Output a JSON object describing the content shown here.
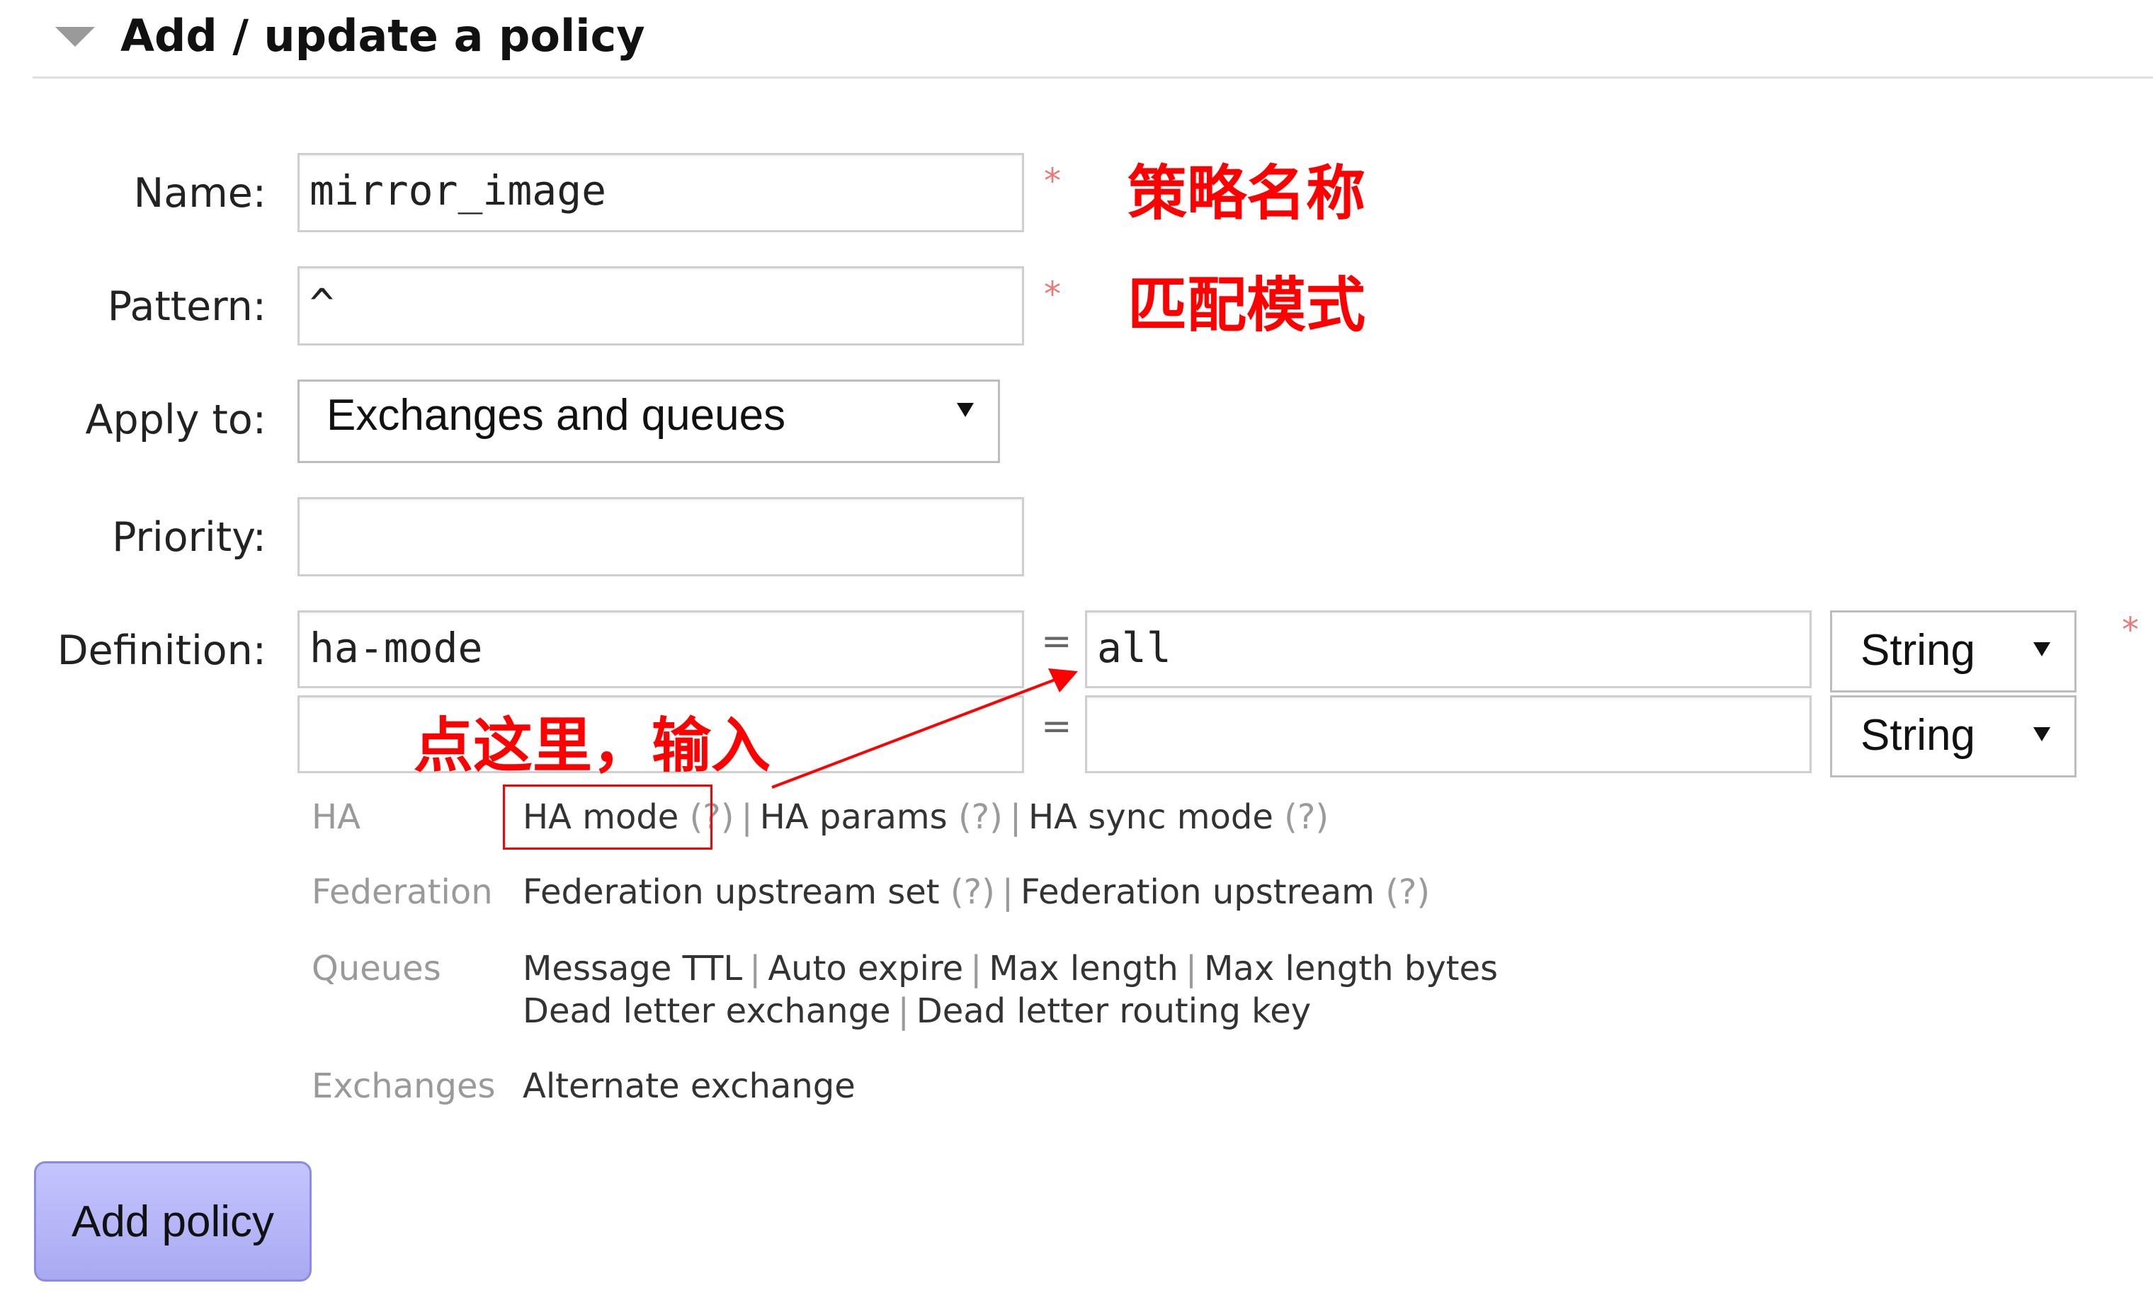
{
  "section": {
    "title": "Add / update a policy"
  },
  "form": {
    "name": {
      "label": "Name:",
      "value": "mirror_image",
      "required_mark": "*",
      "annotation": "策略名称"
    },
    "pattern": {
      "label": "Pattern:",
      "value": "^",
      "required_mark": "*",
      "annotation": "匹配模式"
    },
    "apply_to": {
      "label": "Apply to:",
      "value": "Exchanges and queues"
    },
    "priority": {
      "label": "Priority:",
      "value": ""
    },
    "definition": {
      "label": "Definition:",
      "equals": "=",
      "required_mark": "*",
      "rows": [
        {
          "key": "ha-mode",
          "value": "all",
          "type": "String"
        },
        {
          "key": "",
          "value": "",
          "type": "String"
        }
      ],
      "annotation": "点这里，输入"
    }
  },
  "shortcuts": {
    "ha": {
      "category": "HA",
      "links": [
        {
          "label": "HA mode",
          "help": "(?)"
        },
        {
          "label": "HA params",
          "help": "(?)"
        },
        {
          "label": "HA sync mode",
          "help": "(?)"
        }
      ]
    },
    "federation": {
      "category": "Federation",
      "links": [
        {
          "label": "Federation upstream set",
          "help": "(?)"
        },
        {
          "label": "Federation upstream",
          "help": "(?)"
        }
      ]
    },
    "queues": {
      "category": "Queues",
      "line1": [
        "Message TTL",
        "Auto expire",
        "Max length",
        "Max length bytes"
      ],
      "line2": [
        "Dead letter exchange",
        "Dead letter routing key"
      ]
    },
    "exchanges": {
      "category": "Exchanges",
      "links": [
        "Alternate exchange"
      ]
    },
    "separator": "|"
  },
  "buttons": {
    "add_policy": "Add policy"
  },
  "colors": {
    "annotation": "#ff0000",
    "required": "#ee7777",
    "button": "#b4b4fa"
  }
}
